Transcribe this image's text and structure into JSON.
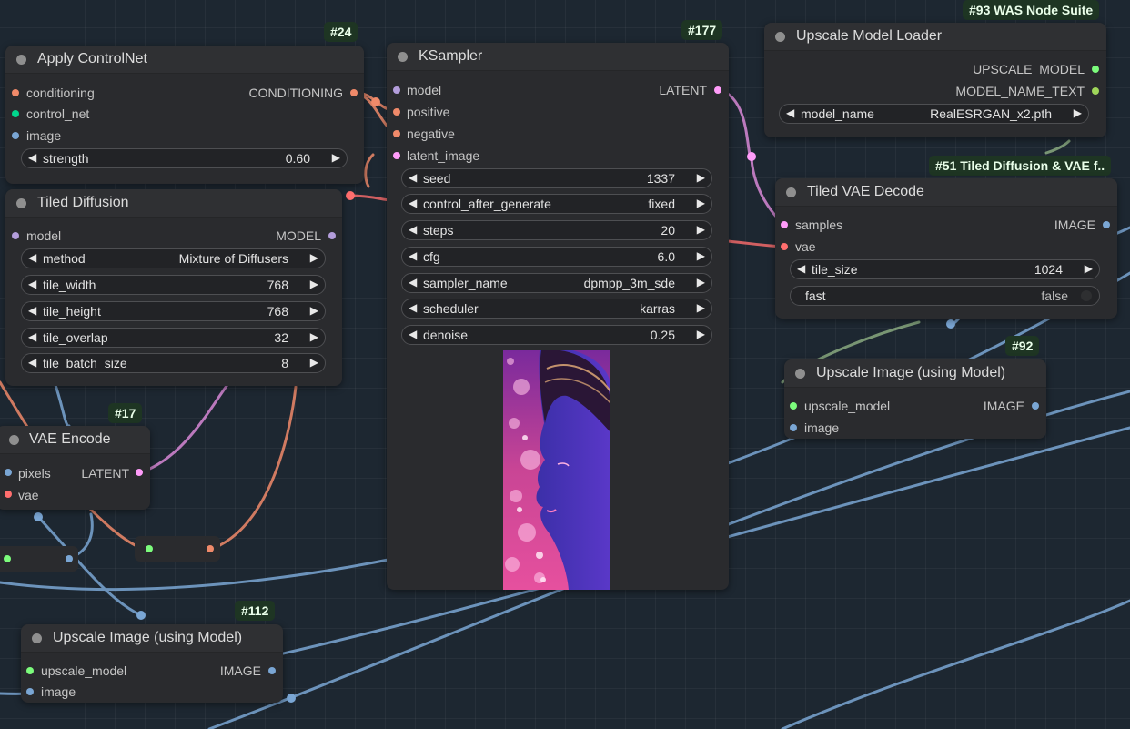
{
  "colors": {
    "canvas": "#1d2731",
    "node_body": "#2a2b2e",
    "node_header": "#2f3033",
    "badge_bg": "#1e3523",
    "conditioning": "#f08a6a",
    "control_net": "#00d78d",
    "image": "#7aa6d4",
    "model": "#b39ddb",
    "latent": "#ff9cf9",
    "vae": "#ff6e6e",
    "upscale_model": "#7cfc7c",
    "string": "#9fd65a"
  },
  "nodes": {
    "apply_controlnet": {
      "badge": "#24",
      "title": "Apply ControlNet",
      "inputs": [
        "conditioning",
        "control_net",
        "image"
      ],
      "output": "CONDITIONING",
      "strength": {
        "label": "strength",
        "value": "0.60"
      }
    },
    "tiled_diffusion": {
      "title": "Tiled Diffusion",
      "input": "model",
      "output": "MODEL",
      "widgets": [
        {
          "label": "method",
          "value": "Mixture of Diffusers"
        },
        {
          "label": "tile_width",
          "value": "768"
        },
        {
          "label": "tile_height",
          "value": "768"
        },
        {
          "label": "tile_overlap",
          "value": "32"
        },
        {
          "label": "tile_batch_size",
          "value": "8"
        }
      ]
    },
    "ksampler": {
      "badge": "#177",
      "title": "KSampler",
      "inputs": [
        "model",
        "positive",
        "negative",
        "latent_image"
      ],
      "output": "LATENT",
      "widgets": [
        {
          "label": "seed",
          "value": "1337"
        },
        {
          "label": "control_after_generate",
          "value": "fixed"
        },
        {
          "label": "steps",
          "value": "20"
        },
        {
          "label": "cfg",
          "value": "6.0"
        },
        {
          "label": "sampler_name",
          "value": "dpmpp_3m_sde"
        },
        {
          "label": "scheduler",
          "value": "karras"
        },
        {
          "label": "denoise",
          "value": "0.25"
        }
      ]
    },
    "upscale_loader": {
      "badge": "#93 WAS Node Suite",
      "title": "Upscale Model Loader",
      "outputs": [
        "UPSCALE_MODEL",
        "MODEL_NAME_TEXT"
      ],
      "model_name": {
        "label": "model_name",
        "value": "RealESRGAN_x2.pth"
      }
    },
    "tiled_vae_decode": {
      "badge": "#51 Tiled Diffusion & VAE f..",
      "title": "Tiled VAE Decode",
      "inputs": [
        "samples",
        "vae"
      ],
      "output": "IMAGE",
      "tile_size": {
        "label": "tile_size",
        "value": "1024"
      },
      "fast": {
        "label": "fast",
        "value": "false"
      }
    },
    "upscale_image_92": {
      "badge": "#92",
      "title": "Upscale Image (using Model)",
      "inputs": [
        "upscale_model",
        "image"
      ],
      "output": "IMAGE"
    },
    "vae_encode": {
      "badge": "#17",
      "title": "VAE Encode",
      "inputs": [
        "pixels",
        "vae"
      ],
      "output": "LATENT"
    },
    "upscale_image_112": {
      "badge": "#112",
      "title": "Upscale Image (using Model)",
      "inputs": [
        "upscale_model",
        "image"
      ],
      "output": "IMAGE"
    }
  },
  "icons": {
    "arrow_left": "◀",
    "arrow_right": "▶"
  }
}
